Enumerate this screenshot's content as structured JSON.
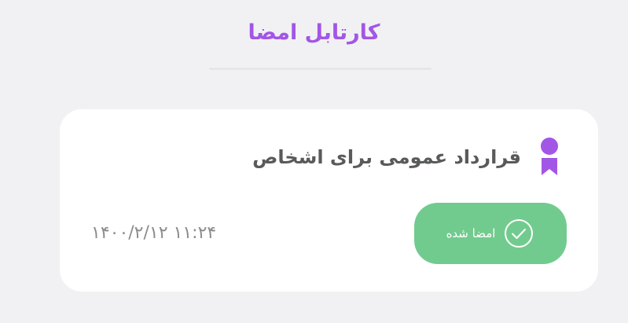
{
  "header": {
    "title": "کارتابل امضا"
  },
  "card": {
    "icon": "award-ribbon-icon",
    "title": "قرارداد عمومی برای اشخاص",
    "status": {
      "label": "امضا شده",
      "icon": "check-circle-icon"
    },
    "datetime": "۱۴۰۰/۲/۱۲ ۱۱:۲۴"
  },
  "colors": {
    "accent": "#a256e6",
    "status_green": "#72cb8e",
    "title_text": "#595a5c",
    "muted_text": "#8b8c8e",
    "background": "#f1f1f4",
    "card": "#ffffff"
  }
}
